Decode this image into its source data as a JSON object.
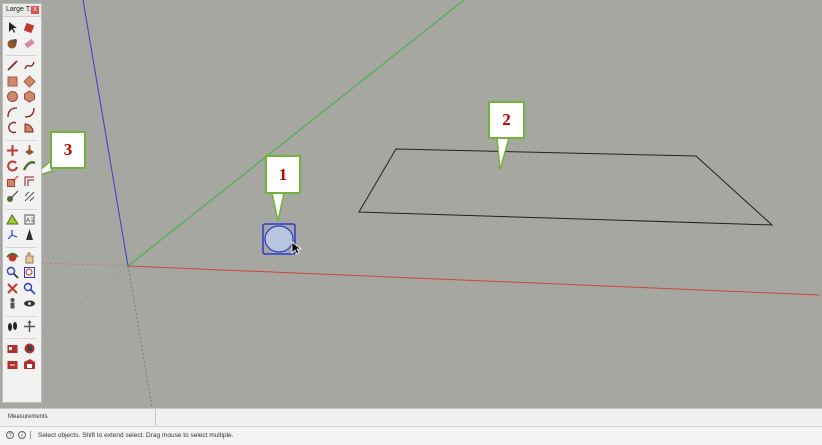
{
  "toolbar": {
    "title": "Large T...",
    "close_glyph": "x",
    "rows": [
      [
        "select-icon",
        "paint-bucket-icon"
      ],
      [
        "component-icon",
        "eraser-icon"
      ],
      [
        "line-icon",
        "freehand-icon"
      ],
      [
        "rectangle-icon",
        "rotated-rectangle-icon"
      ],
      [
        "circle-icon",
        "polygon-icon"
      ],
      [
        "arc-icon",
        "two-point-arc-icon"
      ],
      [
        "three-point-arc-icon",
        "pie-icon"
      ],
      [
        "move-icon",
        "push-pull-icon"
      ],
      [
        "rotate-icon",
        "follow-me-icon"
      ],
      [
        "scale-icon",
        "offset-icon"
      ],
      [
        "tape-measure-icon",
        "dimension-icon"
      ],
      [
        "protractor-icon",
        "text-icon"
      ],
      [
        "axes-icon",
        "3d-text-icon"
      ],
      [
        "orbit-icon",
        "pan-icon"
      ],
      [
        "zoom-icon",
        "zoom-window-icon"
      ],
      [
        "zoom-extents-icon",
        "previous-view-icon"
      ],
      [
        "position-camera-icon",
        "look-around-icon"
      ],
      [
        "walk-icon",
        "section-plane-icon"
      ],
      [
        "warehouse-icon",
        "extension-icon"
      ],
      [
        "share-model-icon",
        "layout-icon"
      ]
    ]
  },
  "callouts": [
    {
      "label": "1"
    },
    {
      "label": "2"
    },
    {
      "label": "3"
    }
  ],
  "measurements": {
    "label": "Measurements"
  },
  "status": {
    "icon_a": "?",
    "icon_b": "i",
    "text": "Select objects. Shift to extend select. Drag mouse to select multiple."
  },
  "colors": {
    "viewport_bg": "#a7a7a1",
    "blue_axis": "#2b3bd0",
    "green_axis": "#3fb03f",
    "red_axis": "#c84a3a",
    "callout_border": "#70b23c",
    "callout_text": "#c00000"
  }
}
